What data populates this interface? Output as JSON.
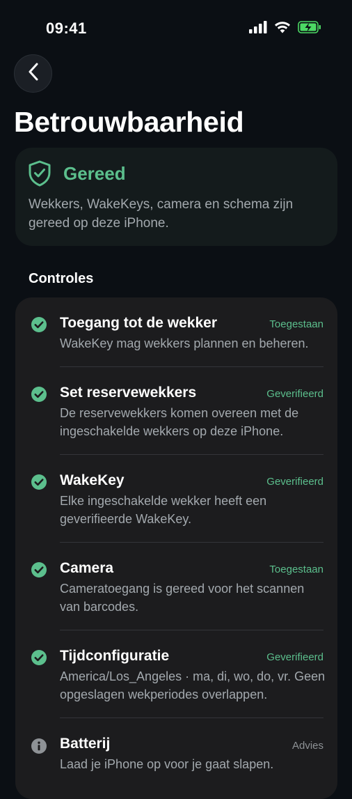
{
  "status_bar": {
    "time": "09:41",
    "signal_icon": "cellular-signal-icon",
    "wifi_icon": "wifi-icon",
    "battery_icon": "battery-charging-icon"
  },
  "navigation": {
    "back_icon": "chevron-left-icon"
  },
  "page": {
    "title": "Betrouwbaarheid"
  },
  "summary": {
    "icon": "shield-check-icon",
    "heading": "Gereed",
    "message": "Wekkers, WakeKeys, camera en schema zijn gereed op deze iPhone."
  },
  "checks": {
    "section_title": "Controles",
    "items": [
      {
        "icon": "checkmark-circle-icon",
        "title": "Toegang tot de wekker",
        "status": "Toegestaan",
        "description": "WakeKey mag wekkers plannen en beheren."
      },
      {
        "icon": "checkmark-circle-icon",
        "title": "Set reservewekkers",
        "status": "Geverifieerd",
        "description": "De reservewekkers komen overeen met de ingeschakelde wekkers op deze iPhone."
      },
      {
        "icon": "checkmark-circle-icon",
        "title": "WakeKey",
        "status": "Geverifieerd",
        "description": "Elke ingeschakelde wekker heeft een geverifieerde WakeKey."
      },
      {
        "icon": "checkmark-circle-icon",
        "title": "Camera",
        "status": "Toegestaan",
        "description": "Cameratoegang is gereed voor het scannen van barcodes."
      },
      {
        "icon": "checkmark-circle-icon",
        "title": "Tijdconfiguratie",
        "status": "Geverifieerd",
        "description": "America/Los_Angeles · ma, di, wo, do, vr. Geen opgeslagen wekperiodes overlappen."
      },
      {
        "icon": "info-circle-icon",
        "title": "Batterij",
        "status": "Advies",
        "description": "Laad je iPhone op voor je gaat slapen."
      }
    ]
  },
  "colors": {
    "background": "#0b0f14",
    "accent_green": "#5cbf8d",
    "card": "#1c1c1e",
    "summary_card": "#141b1c",
    "secondary_text": "#a3a9ae"
  }
}
